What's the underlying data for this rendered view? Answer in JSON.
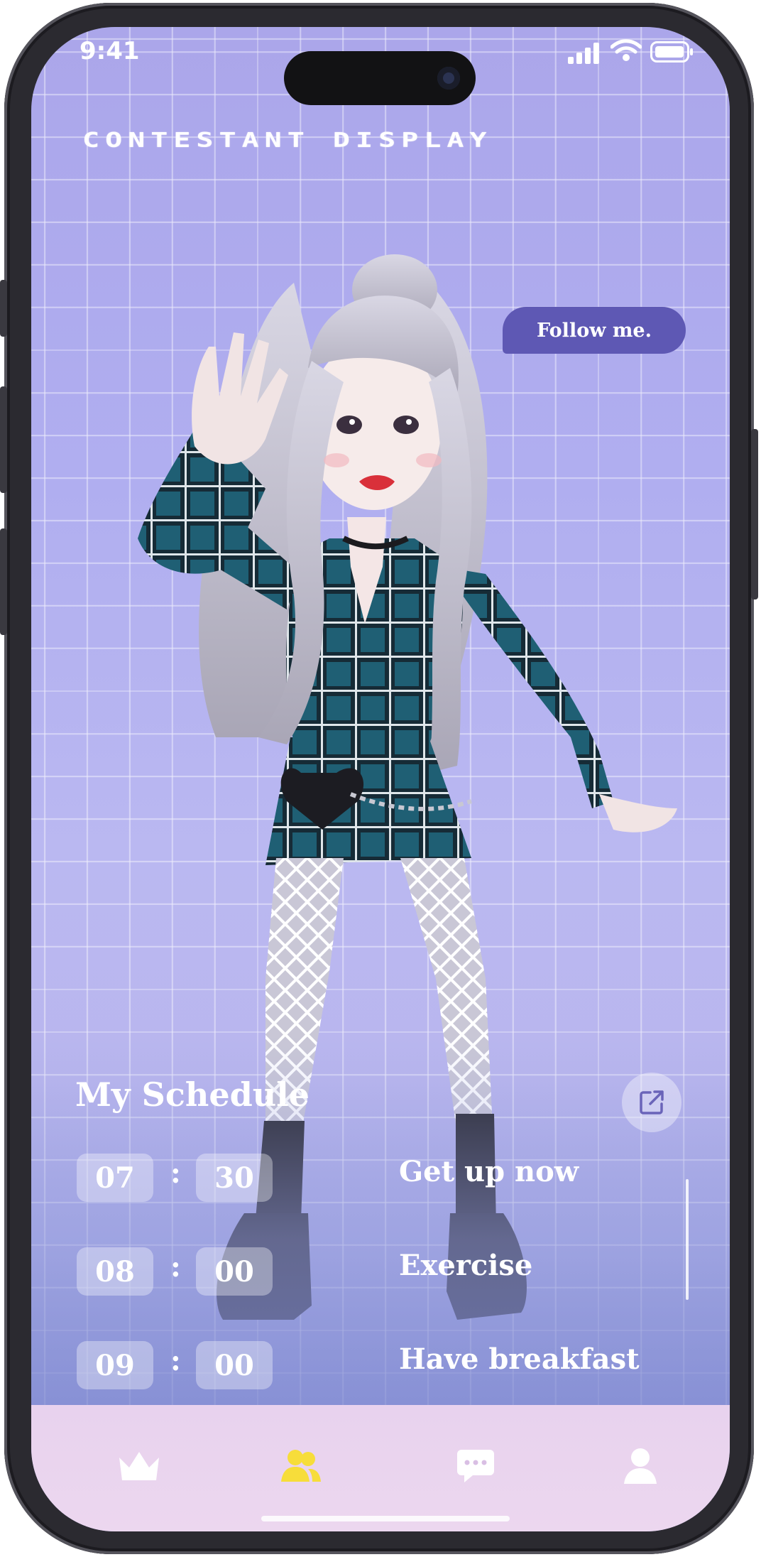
{
  "status_bar": {
    "time": "9:41"
  },
  "header": {
    "title": "CONTESTANT DISPLAY"
  },
  "bubble": {
    "text": "Follow me."
  },
  "schedule": {
    "title": "My Schedule",
    "items": [
      {
        "hour": "07",
        "minute": "30",
        "task": "Get up now"
      },
      {
        "hour": "08",
        "minute": "00",
        "task": "Exercise"
      },
      {
        "hour": "09",
        "minute": "00",
        "task": "Have breakfast"
      }
    ],
    "separator": ":"
  },
  "tabbar": {
    "items": [
      {
        "icon": "crown-icon",
        "active": false
      },
      {
        "icon": "users-icon",
        "active": true
      },
      {
        "icon": "chat-icon",
        "active": false
      },
      {
        "icon": "profile-icon",
        "active": false
      }
    ],
    "active_color": "#f7dd3a",
    "inactive_color": "#ffffff"
  },
  "colors": {
    "bubble": "#5e58b4",
    "background_top": "#aba6ea",
    "background_bottom": "#8c95d9"
  }
}
